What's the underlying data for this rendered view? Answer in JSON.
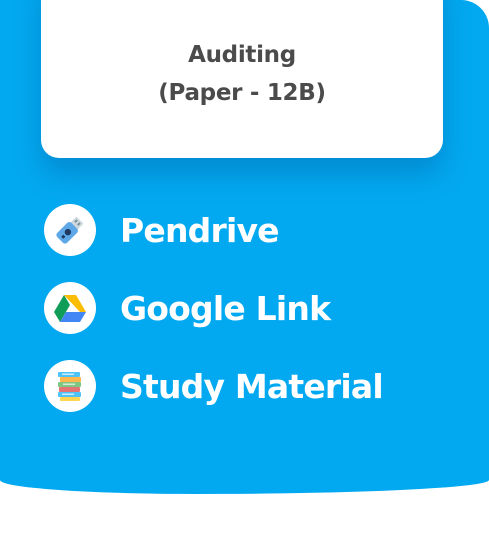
{
  "card": {
    "title": "Auditing",
    "subtitle": "(Paper - 12B)"
  },
  "items": [
    {
      "label": "Pendrive",
      "icon": "pendrive-icon"
    },
    {
      "label": "Google Link",
      "icon": "google-drive-icon"
    },
    {
      "label": "Study Material",
      "icon": "books-icon"
    }
  ],
  "colors": {
    "background": "#03a9f0",
    "card": "#ffffff",
    "card_text": "#4b4b4b",
    "item_text": "#ffffff"
  }
}
